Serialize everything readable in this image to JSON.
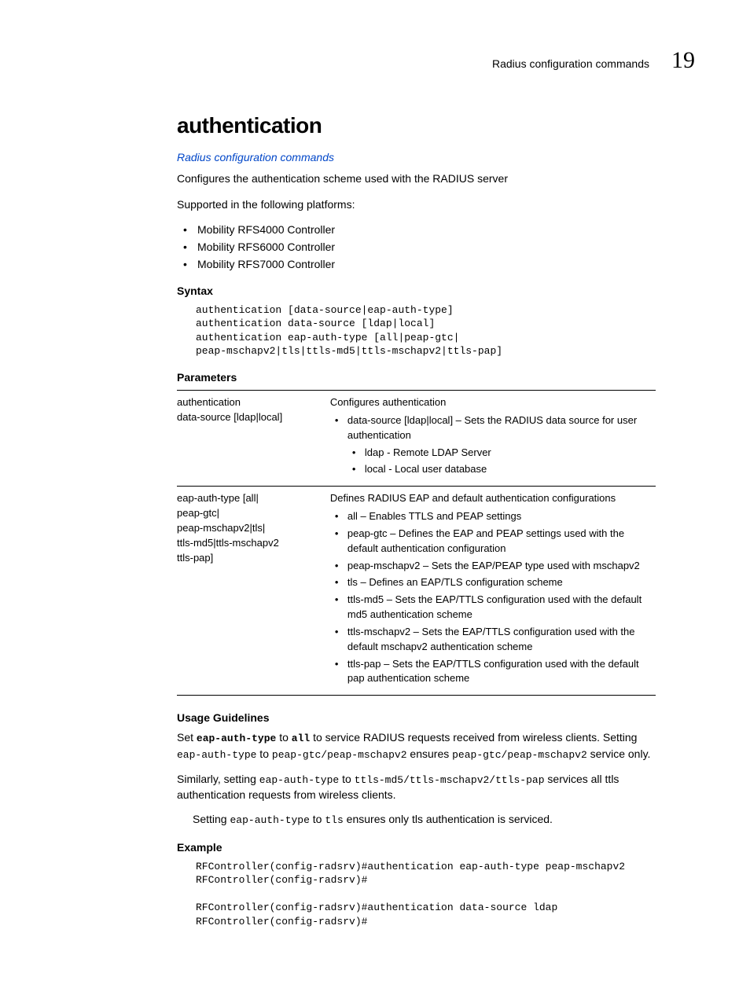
{
  "header": {
    "section": "Radius configuration commands",
    "chapter": "19"
  },
  "title": "authentication",
  "breadcrumb": "Radius configuration commands",
  "intro1": "Configures the authentication scheme used with the RADIUS server",
  "intro2": "Supported in the following platforms:",
  "platforms": [
    "Mobility RFS4000 Controller",
    "Mobility RFS6000 Controller",
    "Mobility RFS7000 Controller"
  ],
  "syntax": {
    "heading": "Syntax",
    "code": "authentication [data-source|eap-auth-type]\nauthentication data-source [ldap|local]\nauthentication eap-auth-type [all|peap-gtc|\npeap-mschapv2|tls|ttls-md5|ttls-mschapv2|ttls-pap]"
  },
  "parameters": {
    "heading": "Parameters",
    "row1": {
      "key_l1": "authentication",
      "key_l2": "data-source [ldap|local]",
      "desc_top": "Configures authentication",
      "b1": "data-source [ldap|local] – Sets the RADIUS data source for user authentication",
      "b1a": "ldap - Remote LDAP Server",
      "b1b": "local - Local user database"
    },
    "row2": {
      "key_l1": "eap-auth-type [all|",
      "key_l2": "peap-gtc|",
      "key_l3": "peap-mschapv2|tls|",
      "key_l4": "ttls-md5|ttls-mschapv2",
      "key_l5": "ttls-pap]",
      "desc_top": "Defines RADIUS EAP and default authentication configurations",
      "b1": "all – Enables TTLS and PEAP settings",
      "b2": "peap-gtc – Defines the EAP and PEAP settings used with the default authentication configuration",
      "b3": "peap-mschapv2 – Sets the EAP/PEAP type used with mschapv2",
      "b4": "tls – Defines an EAP/TLS configuration scheme",
      "b5": "ttls-md5 – Sets the EAP/TTLS configuration used with the default md5 authentication scheme",
      "b6": "ttls-mschapv2 – Sets the EAP/TTLS configuration used with the default mschapv2 authentication scheme",
      "b7": "ttls-pap – Sets the EAP/TTLS configuration used with the default pap authentication scheme"
    }
  },
  "usage": {
    "heading": "Usage Guidelines",
    "p1_pre": "Set ",
    "p1_m1": "eap-auth-type",
    "p1_mid1": " to ",
    "p1_m2": "all",
    "p1_mid2": " to service RADIUS requests received from wireless clients. Setting ",
    "p1_m3": "eap-auth-type",
    "p1_mid3": " to ",
    "p1_m4": "peap-gtc/peap-mschapv2",
    "p1_mid4": " ensures ",
    "p1_m5": "peap-gtc/peap-mschapv2",
    "p1_end": " service only.",
    "p2_pre": "Similarly, setting ",
    "p2_m1": "eap-auth-type",
    "p2_mid1": " to ",
    "p2_m2": "ttls-md5/ttls-mschapv2/ttls-pap",
    "p2_end": " services all ttls authentication requests from wireless clients.",
    "p3_pre": "Setting ",
    "p3_m1": "eap-auth-type",
    "p3_mid1": " to ",
    "p3_m2": "tls",
    "p3_end": " ensures only tls authentication is serviced."
  },
  "example": {
    "heading": "Example",
    "code": "RFController(config-radsrv)#authentication eap-auth-type peap-mschapv2\nRFController(config-radsrv)#\n\nRFController(config-radsrv)#authentication data-source ldap\nRFController(config-radsrv)#"
  }
}
